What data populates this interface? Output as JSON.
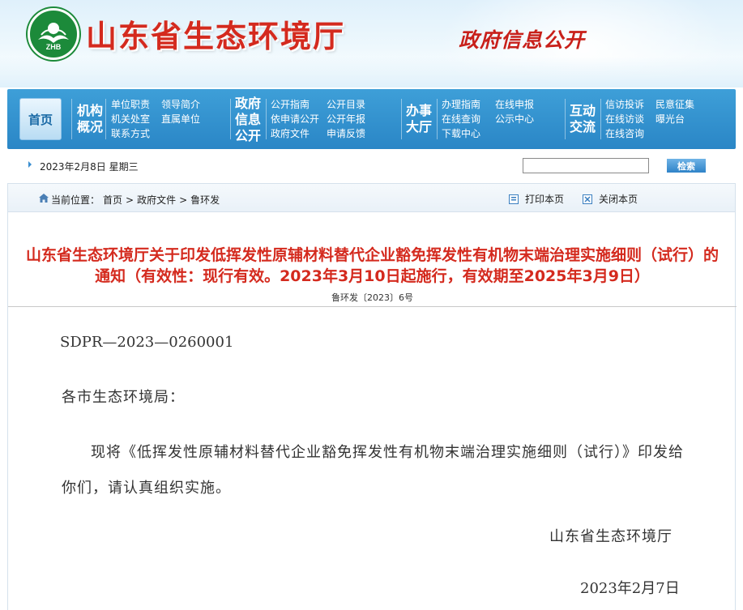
{
  "header": {
    "logo_text": "ZHB",
    "site_title": "山东省生态环境厅",
    "slogan": "政府信息公开"
  },
  "nav": {
    "home": "首页",
    "groups": [
      {
        "title_lines": [
          "机构",
          "概况"
        ],
        "links": [
          "单位职责",
          "领导简介",
          "机关处室",
          "直属单位",
          "联系方式"
        ]
      },
      {
        "title_lines": [
          "政府",
          "信息",
          "公开"
        ],
        "links": [
          "公开指南",
          "公开目录",
          "依申请公开",
          "公开年报",
          "政府文件",
          "申请反馈"
        ]
      },
      {
        "title_lines": [
          "办事",
          "大厅"
        ],
        "links": [
          "办理指南",
          "在线申报",
          "在线查询",
          "公示中心",
          "下载中心"
        ]
      },
      {
        "title_lines": [
          "互动",
          "交流"
        ],
        "links": [
          "信访投诉",
          "民意征集",
          "在线访谈",
          "曝光台",
          "在线咨询"
        ]
      }
    ]
  },
  "datebar": {
    "date": "2023年2月8日 星期三",
    "search_value": "",
    "search_button": "检索"
  },
  "breadcrumb": {
    "label": "当前位置：",
    "items": [
      "首页",
      ">",
      "政府文件",
      ">",
      "鲁环发"
    ],
    "print": "打印本页",
    "close": "关闭本页"
  },
  "article": {
    "title_line1": "山东省生态环境厅关于印发低挥发性原辅材料替代企业豁免挥发性有机物末端治理实施细则（试行）的",
    "title_line2": "通知（有效性：现行有效。2023年3月10日起施行，有效期至2025年3月9日）",
    "doc_number": "鲁环发〔2023〕6号",
    "code": "SDPR—2023—0260001",
    "salutation": "各市生态环境局：",
    "paragraph": "现将《低挥发性原辅材料替代企业豁免挥发性有机物末端治理实施细则（试行）》印发给你们，请认真组织实施。",
    "signature": "山东省生态环境厅",
    "sign_date": "2023年2月7日"
  },
  "colors": {
    "title_red": "#d42a1e",
    "nav_blue": "#2a86c6",
    "logo_green": "#1c8a3a"
  }
}
